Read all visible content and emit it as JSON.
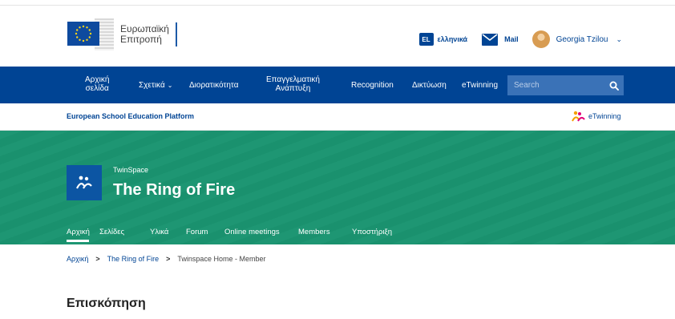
{
  "header": {
    "logo_line1": "Ευρωπαϊκή",
    "logo_line2": "Επιτροπή",
    "language_code": "EL",
    "language_label": "ελληνικά",
    "mail_label": "Mail",
    "user_name": "Georgia Tzilou",
    "user_chevron": "⌄"
  },
  "nav": {
    "items": [
      {
        "line1": "Αρχική",
        "line2": "σελίδα"
      },
      {
        "label": "Σχετικά",
        "chevron": "⌄"
      },
      {
        "label": "Διορατικότητα"
      },
      {
        "line1": "Επαγγελματική",
        "line2": "Ανάπτυξη"
      },
      {
        "label": "Recognition"
      },
      {
        "label": "Δικτύωση"
      },
      {
        "label": "eTwinning"
      }
    ],
    "search_placeholder": "Search"
  },
  "platform": {
    "title": "European School Education Platform",
    "etwinning_label": "eTwinning"
  },
  "space": {
    "kicker": "TwinSpace",
    "title": "The Ring of Fire",
    "tabs": [
      "Αρχική",
      "Σελίδες",
      "Υλικά",
      "Forum",
      "Online meetings",
      "Members",
      "Υποστήριξη"
    ]
  },
  "breadcrumb": {
    "items": [
      "Αρχική",
      "The Ring of Fire",
      "Twinspace Home - Member"
    ],
    "separator": ">"
  },
  "overview": {
    "title": "Επισκόπηση"
  },
  "colors": {
    "brand_blue": "#004494",
    "hero_green": "#1a9470",
    "search_blue": "#3a72b7"
  }
}
